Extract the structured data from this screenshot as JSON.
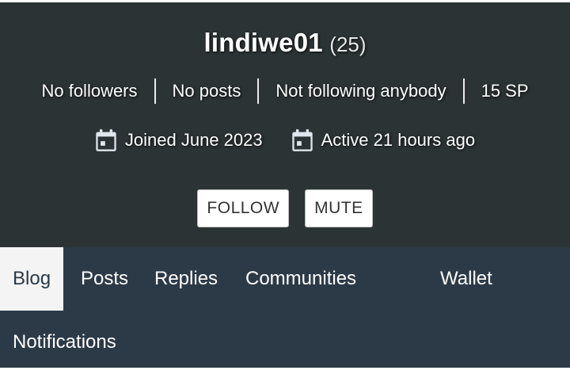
{
  "profile": {
    "username": "lindiwe01",
    "reputation": "(25)",
    "stats": [
      "No followers",
      "No posts",
      "Not following anybody",
      "15 SP"
    ],
    "joined": "Joined June 2023",
    "active": "Active 21 hours ago",
    "icons": [
      "calendar-icon",
      "calendar-icon"
    ]
  },
  "actions": {
    "follow": "FOLLOW",
    "mute": "MUTE"
  },
  "tabs": [
    "Blog",
    "Posts",
    "Replies",
    "Communities",
    "Wallet",
    "Notifications"
  ],
  "colors": {
    "header_bg": "#2c3335",
    "tabs_bg": "#2c3a48",
    "active_tab_bg": "#f4f4f4"
  }
}
